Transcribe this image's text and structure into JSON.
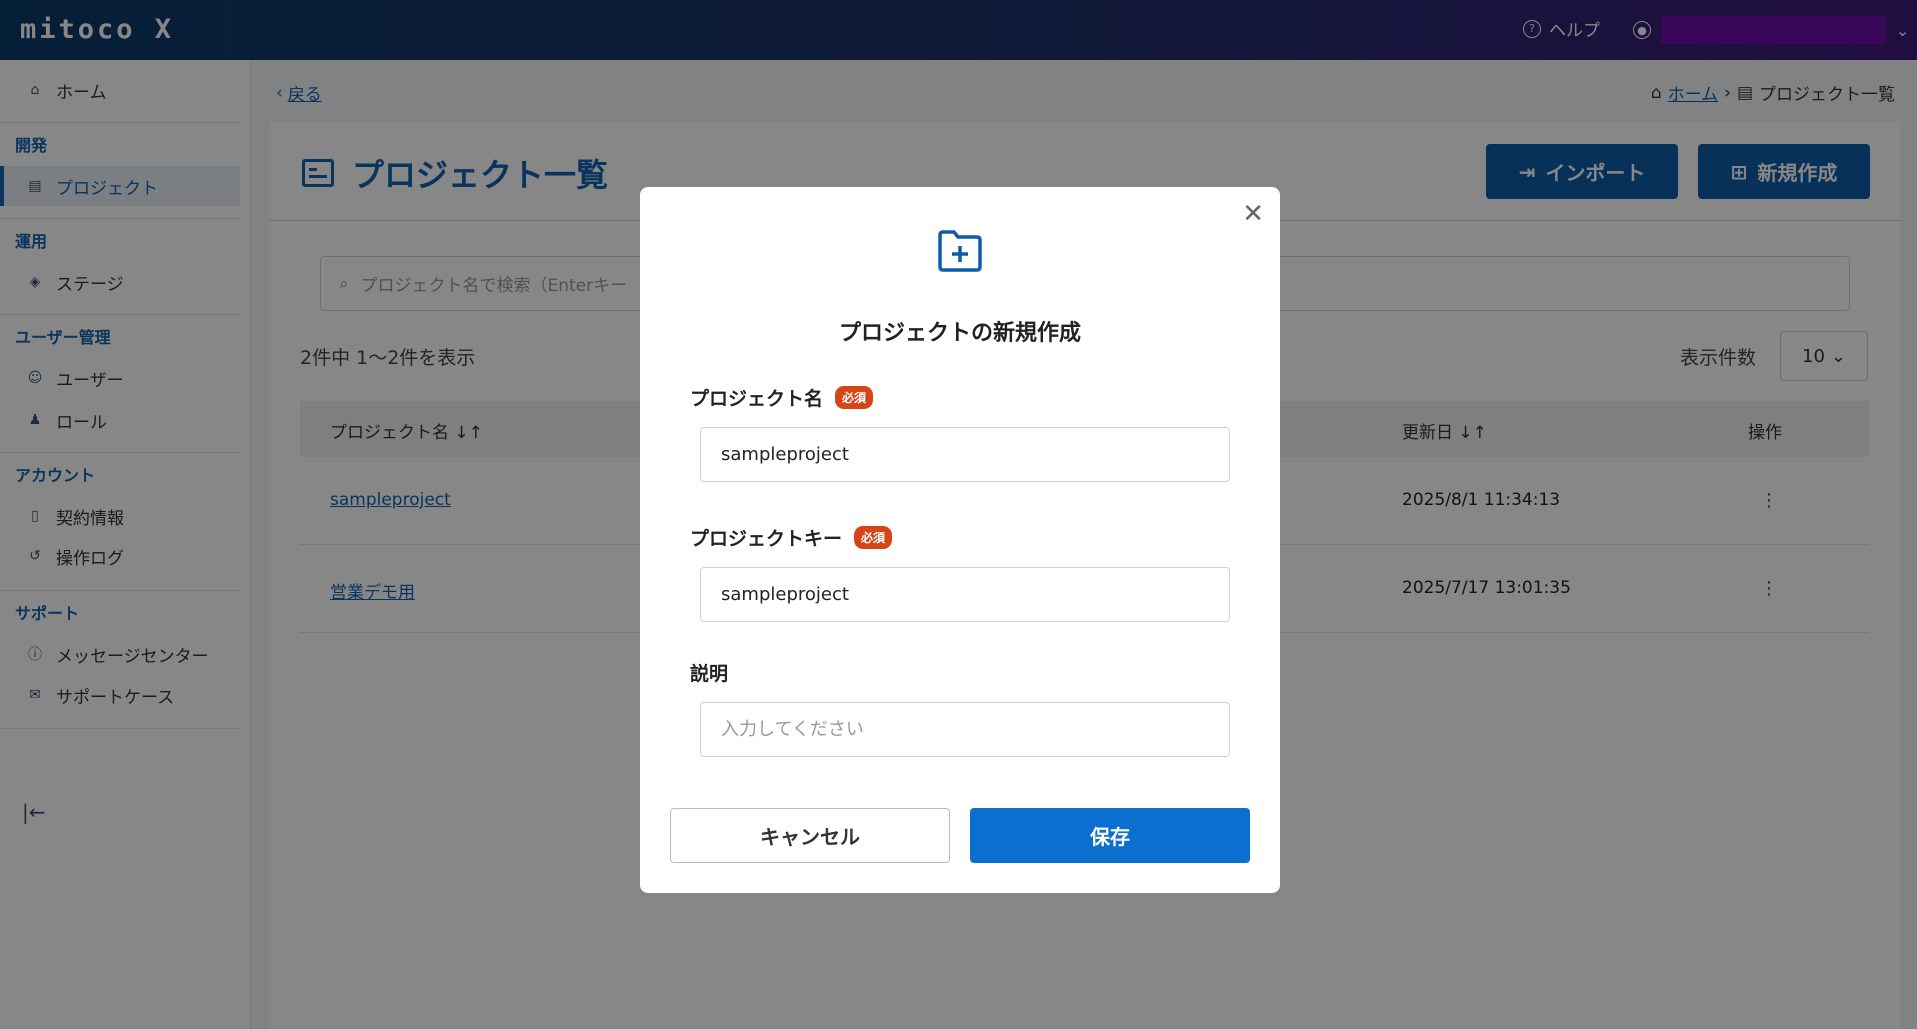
{
  "header": {
    "logo": "mitoco X",
    "help_label": "ヘルプ"
  },
  "sidebar": {
    "home": "ホーム",
    "cat_dev": "開発",
    "project": "プロジェクト",
    "cat_ops": "運用",
    "stage": "ステージ",
    "cat_user_mgmt": "ユーザー管理",
    "user": "ユーザー",
    "role": "ロール",
    "cat_account": "アカウント",
    "contract": "契約情報",
    "oplog": "操作ログ",
    "cat_support": "サポート",
    "message_center": "メッセージセンター",
    "support_case": "サポートケース"
  },
  "main": {
    "back_label": "戻る",
    "breadcrumb_home": "ホーム",
    "breadcrumb_current": "プロジェクト一覧",
    "title": "プロジェクト一覧",
    "import_label": "インポート",
    "new_label": "新規作成",
    "search_placeholder": "プロジェクト名で検索（Enterキー",
    "count_text": "2件中 1～2件を表示",
    "per_page_label": "表示件数",
    "per_page_value": "10",
    "table": {
      "col_name": "プロジェクト名 ↓↑",
      "col_updated": "更新日 ↓↑",
      "col_ops": "操作",
      "rows": [
        {
          "name": "sampleproject",
          "updated": "2025/8/1 11:34:13"
        },
        {
          "name": "営業デモ用",
          "updated": "2025/7/17 13:01:35"
        }
      ]
    }
  },
  "modal": {
    "title": "プロジェクトの新規作成",
    "name_label": "プロジェクト名",
    "required_badge": "必須",
    "name_value": "sampleproject",
    "key_label": "プロジェクトキー",
    "key_value": "sampleproject",
    "desc_label": "説明",
    "desc_placeholder": "入力してください",
    "cancel_label": "キャンセル",
    "save_label": "保存"
  },
  "colors": {
    "brand": "#1062b0",
    "save_button": "#0a6fcf",
    "required_badge": "#d64516"
  }
}
